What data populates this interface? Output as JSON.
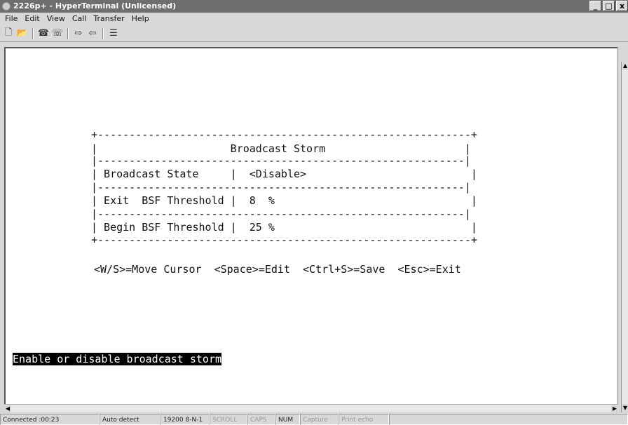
{
  "window": {
    "title": "2226p+ - HyperTerminal (Unlicensed)",
    "controls": {
      "minimize": "_",
      "maximize": "□",
      "close": "x"
    }
  },
  "menu": [
    "File",
    "Edit",
    "View",
    "Call",
    "Transfer",
    "Help"
  ],
  "toolbar": {
    "icons": [
      "new-connection-icon",
      "open-icon",
      "connect-icon",
      "disconnect-icon",
      "send-icon",
      "receive-icon",
      "properties-icon"
    ]
  },
  "terminal": {
    "border_top": "+-----------------------------------------------------------+",
    "title_row": "|                     Broadcast Storm                      |",
    "sep_1": "|----------------------------------------------------------|",
    "row_1": "| Broadcast State     |  <Disable>                          |",
    "sep_2": "|----------------------------------------------------------|",
    "row_2": "| Exit  BSF Threshold |  8  %                               |",
    "sep_3": "|----------------------------------------------------------|",
    "row_3": "| Begin BSF Threshold |  25 %                               |",
    "border_bottom": "+-----------------------------------------------------------+",
    "hint": "<W/S>=Move Cursor  <Space>=Edit  <Ctrl+S>=Save  <Esc>=Exit",
    "status_message": "Enable or disable broadcast storm"
  },
  "statusbar": {
    "connected": "Connected :00:23",
    "detect": "Auto detect",
    "settings": "19200 8-N-1",
    "scroll": "SCROLL",
    "caps": "CAPS",
    "num": "NUM",
    "capture": "Capture",
    "print_echo": "Print echo"
  }
}
